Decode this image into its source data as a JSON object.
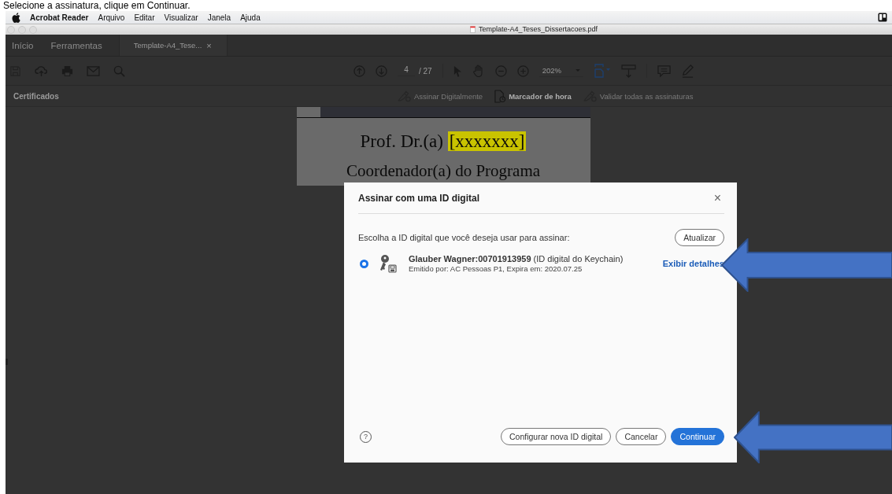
{
  "caption": "Selecione a assinatura, clique em Continuar.",
  "menu_bar": {
    "app": "Acrobat Reader",
    "items": [
      "Arquivo",
      "Editar",
      "Visualizar",
      "Janela",
      "Ajuda"
    ]
  },
  "window": {
    "title": "Template-A4_Teses_Dissertacoes.pdf"
  },
  "tabs": [
    {
      "label": "Início",
      "selected": false
    },
    {
      "label": "Ferramentas",
      "selected": false
    },
    {
      "label": "Template-A4_Tese...",
      "selected": true,
      "close": "×"
    }
  ],
  "toolbar": {
    "page": "4",
    "page_count": "/ 27",
    "zoom": "202%"
  },
  "certificates": {
    "title": "Certificados",
    "actions": [
      {
        "label": "Assinar Digitalmente",
        "disabled": true
      },
      {
        "label": "Marcador de hora",
        "disabled": false
      },
      {
        "label": "Validar todas as assinaturas",
        "disabled": true
      }
    ]
  },
  "document": {
    "name_prefix": "Prof. Dr.(a)",
    "name_placeholder": "[xxxxxxx]",
    "role": "Coordenador(a) do Programa"
  },
  "dialog": {
    "title": "Assinar com uma ID digital",
    "close": "×",
    "prompt": "Escolha a ID digital que você deseja usar para assinar:",
    "refresh": "Atualizar",
    "ids": [
      {
        "name": "Glauber Wagner:00701913959",
        "source": "(ID digital do Keychain)",
        "details": "Emitido por: AC Pessoas P1, Expira em: 2020.07.25",
        "link": "Exibir detalhes",
        "selected": true
      }
    ],
    "help": "?",
    "buttons": [
      {
        "label": "Configurar nova ID digital",
        "primary": false
      },
      {
        "label": "Cancelar",
        "primary": false
      },
      {
        "label": "Continuar",
        "primary": true
      }
    ]
  }
}
